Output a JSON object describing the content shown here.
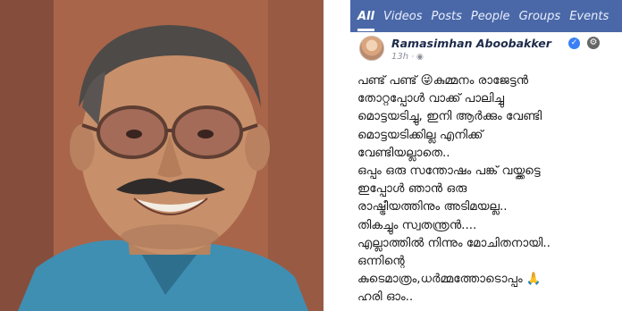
{
  "tabs": [
    "All",
    "Videos",
    "Posts",
    "People",
    "Groups",
    "Events"
  ],
  "post": {
    "author": "Ramasimhan Aboobakker",
    "time": "13h",
    "lines": [
      "പണ്ട് പണ്ട് 😜കുമ്മനം രാജേട്ടൻ",
      "തോറ്റപ്പോൾ വാക്ക് പാലിച്ചു",
      "മൊട്ടയടിച്ചു, ഇനി ആർക്കും വേണ്ടി",
      "മൊട്ടയടിക്കില്ല എനിക്ക്",
      "വേണ്ടിയല്ലാതെ..",
      "ഒപ്പം ഒരു സന്തോഷം പങ്ക് വയ്ക്കട്ടെ",
      "ഇപ്പോൾ ഞാൻ ഒരു",
      "രാഷ്ട്രീയത്തിനും അടിമയല്ല..",
      "തികച്ചും സ്വതന്ത്രൻ....",
      "എല്ലാത്തിൽ നിന്നും മോചിതനായി..",
      "ഒന്നിന്റെ",
      "കുടെമാത്രം,ധർമ്മത്തോടൊപ്പം 🙏",
      "ഹരി ഓം.."
    ]
  },
  "icons": {
    "verified": "verified-badge-icon",
    "settings": "gear-icon",
    "privacy": "globe-icon"
  },
  "colors": {
    "tab_bar": "#4a68a8",
    "verified": "#3b7ff5"
  }
}
